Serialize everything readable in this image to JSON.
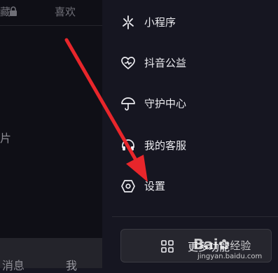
{
  "left_page": {
    "tabs": {
      "collections_partial": "藏",
      "likes": "喜欢"
    },
    "content_partial": "片",
    "bottom_nav": {
      "messages": "消息",
      "me": "我"
    }
  },
  "drawer": {
    "items": [
      {
        "label": "小程序",
        "icon": "mini-program-icon"
      },
      {
        "label": "抖音公益",
        "icon": "charity-heart-icon"
      },
      {
        "label": "守护中心",
        "icon": "umbrella-icon"
      },
      {
        "label": "我的客服",
        "icon": "headset-icon"
      },
      {
        "label": "设置",
        "icon": "settings-hexagon-icon"
      }
    ],
    "more_button": {
      "label": "更多功能",
      "icon": "grid-icon"
    }
  },
  "watermark": {
    "logo": "Bai",
    "logo_tail": "经验",
    "url": "jingyan.baidu.com"
  },
  "colors": {
    "drawer_bg": "#161621",
    "arrow": "#e8262b"
  }
}
